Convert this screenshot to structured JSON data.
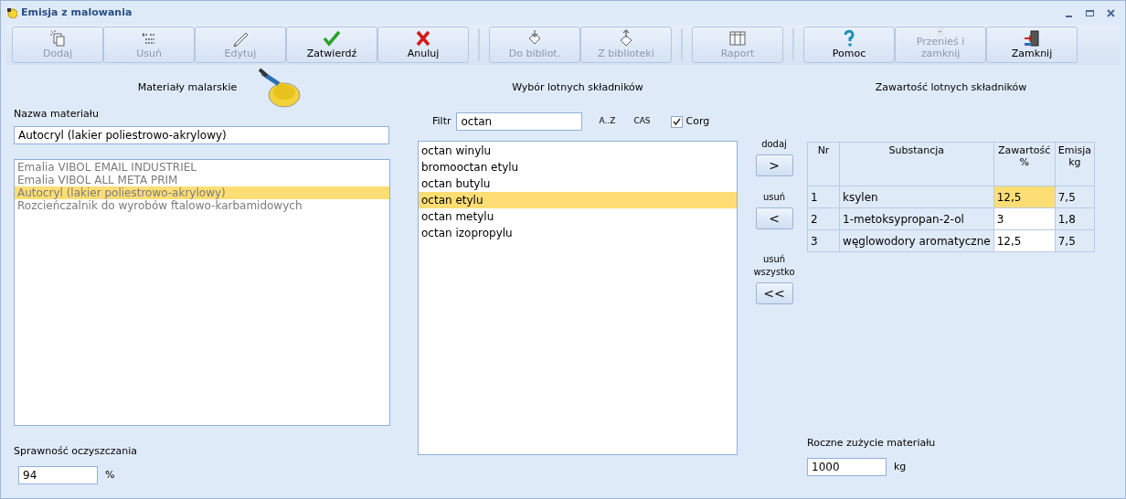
{
  "window": {
    "title": "Emisja z malowania"
  },
  "toolbar": [
    [
      {
        "label": "Dodaj",
        "disabled": true
      },
      {
        "label": "Usuń",
        "disabled": true
      },
      {
        "label": "Edytuj",
        "disabled": true
      },
      {
        "label": "Zatwierdź",
        "disabled": false
      },
      {
        "label": "Anuluj",
        "disabled": false
      }
    ],
    [
      {
        "label": "Do bibliot.",
        "disabled": true
      },
      {
        "label": "Z biblioteki",
        "disabled": true
      }
    ],
    [
      {
        "label": "Raport",
        "disabled": true
      }
    ],
    [
      {
        "label": "Pomoc",
        "disabled": false
      },
      {
        "label": "Przenieś i zamknij",
        "disabled": true
      },
      {
        "label": "Zamknij",
        "disabled": false
      }
    ]
  ],
  "materials": {
    "heading": "Materiały malarskie",
    "name_label": "Nazwa materiału",
    "name_value": "Autocryl (lakier poliestrowo-akrylowy)",
    "items": [
      {
        "label": "Emalia VIBOL EMAIL INDUSTRIEL",
        "selected": false
      },
      {
        "label": "Emalia VIBOL ALL META PRIM",
        "selected": false
      },
      {
        "label": "Autocryl (lakier poliestrowo-akrylowy)",
        "selected": true
      },
      {
        "label": "Rozcieńczalnik do wyrobów ftalowo-karbamidowych",
        "selected": false
      }
    ],
    "efficiency_label": "Sprawność oczyszczania",
    "efficiency_value": "94",
    "efficiency_unit": "%"
  },
  "components": {
    "heading": "Wybór lotnych składników",
    "filter_label": "Filtr",
    "filter_value": "octan",
    "sort_az": "A..Z",
    "sort_cas": "CAS",
    "corg": {
      "label": "Corg",
      "checked": true
    },
    "items": [
      {
        "label": "octan winylu",
        "selected": false
      },
      {
        "label": "bromooctan etylu",
        "selected": false
      },
      {
        "label": "octan butylu",
        "selected": false
      },
      {
        "label": "octan etylu",
        "selected": true
      },
      {
        "label": "octan metylu",
        "selected": false
      },
      {
        "label": "octan izopropylu",
        "selected": false
      }
    ]
  },
  "transfer": [
    {
      "caption": "dodaj",
      "symbol": ">"
    },
    {
      "caption": "usuń",
      "symbol": "<"
    },
    {
      "caption": "usuń wszystko",
      "symbol": "<<"
    }
  ],
  "content": {
    "heading": "Zawartość lotnych składników",
    "table": {
      "columns": [
        "Nr",
        "Substancja",
        "Zawartość %",
        "Emisja kg"
      ],
      "rows": [
        {
          "cells": [
            "1",
            "ksylen",
            "12,5",
            "7,5"
          ],
          "selected": true
        },
        {
          "cells": [
            "2",
            "1-metoksypropan-2-ol",
            "3",
            "1,8"
          ],
          "selected": false
        },
        {
          "cells": [
            "3",
            "węglowodory aromatyczne",
            "12,5",
            "7,5"
          ],
          "selected": false
        }
      ]
    },
    "usage_label": "Roczne zużycie materiału",
    "usage_value": "1000",
    "usage_unit": "kg"
  }
}
